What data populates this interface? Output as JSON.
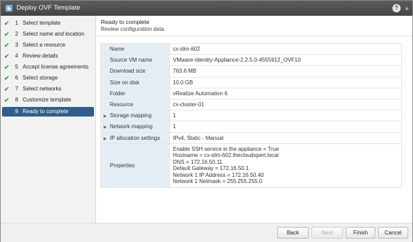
{
  "window": {
    "title": "Deploy OVF Template",
    "help_glyph": "?",
    "expand_glyph": "»"
  },
  "sidebar": {
    "steps": [
      {
        "num": "1",
        "label": "Select template",
        "done": true
      },
      {
        "num": "2",
        "label": "Select name and location",
        "done": true
      },
      {
        "num": "3",
        "label": "Select a resource",
        "done": true
      },
      {
        "num": "4",
        "label": "Review details",
        "done": true
      },
      {
        "num": "5",
        "label": "Accept license agreements",
        "done": true
      },
      {
        "num": "6",
        "label": "Select storage",
        "done": true
      },
      {
        "num": "7",
        "label": "Select networks",
        "done": true
      },
      {
        "num": "8",
        "label": "Customize template",
        "done": true
      },
      {
        "num": "9",
        "label": "Ready to complete",
        "done": false,
        "active": true
      }
    ],
    "check_glyph": "✔"
  },
  "header": {
    "title": "Ready to complete",
    "subtitle": "Review configuration data."
  },
  "summary": {
    "rows": [
      {
        "key": "Name",
        "value": "cx-idm-602"
      },
      {
        "key": "Source VM name",
        "value": "VMware-Identity-Appliance-2.2.5.0-4555912_OVF10"
      },
      {
        "key": "Download size",
        "value": "763.6 MB"
      },
      {
        "key": "Size on disk",
        "value": "10.0 GB"
      },
      {
        "key": "Folder",
        "value": "vRealize Automation 6"
      },
      {
        "key": "Resource",
        "value": "cx-cluster-01"
      },
      {
        "key": "Storage mapping",
        "value": "1"
      },
      {
        "key": "Network mapping",
        "value": "1"
      },
      {
        "key": "IP allocation settings",
        "value": "IPv4, Static - Manual"
      }
    ],
    "properties": {
      "key": "Properties",
      "lines": [
        "Enable SSH service in the appliance = True",
        "Hostname = cx-idm-602.thecloudxpert.local",
        "DNS = 172.16.50.11",
        "Default Gateway = 172.16.50.1",
        "Network 1 IP Address = 172.16.50.40",
        "Network 1 Netmask = 255.255.255.0"
      ]
    },
    "expand_glyph": "▶"
  },
  "footer": {
    "back_label": "Back",
    "next_label": "Next",
    "finish_label": "Finish",
    "cancel_label": "Cancel"
  },
  "colors": {
    "titlebar": "#4a4a4a",
    "active_step": "#2f5f8a",
    "check": "#3f9a3f",
    "key_cell": "#e6eef5"
  }
}
